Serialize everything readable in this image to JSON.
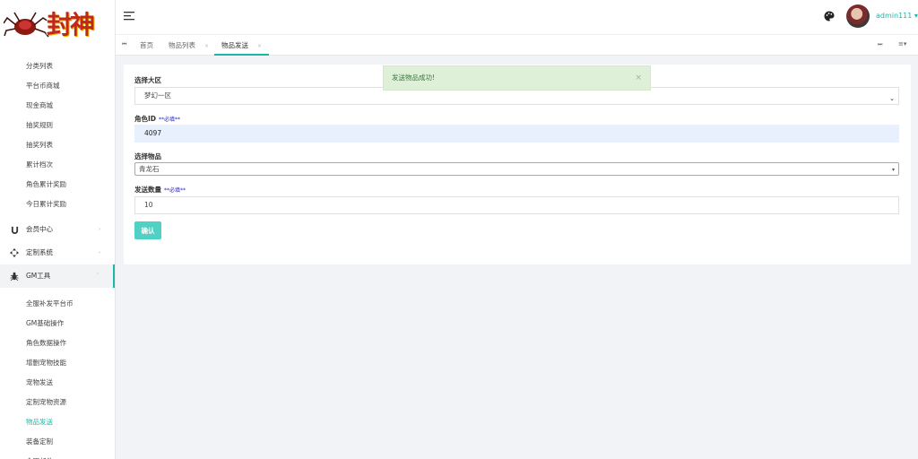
{
  "logo": {
    "text": "封神"
  },
  "sidebar": {
    "items_top": [
      "分类列表",
      "平台币商城",
      "现金商城",
      "抽奖规则",
      "抽奖列表",
      "累计档次",
      "角色累计奖励",
      "今日累计奖励"
    ],
    "groups": [
      {
        "label": "会员中心",
        "icon": "magnet-icon"
      },
      {
        "label": "定制系统",
        "icon": "move-icon"
      },
      {
        "label": "GM工具",
        "icon": "bug-icon"
      }
    ],
    "items_gm": [
      "全服补发平台币",
      "GM基础操作",
      "角色数据操作",
      "增删宠物技能",
      "宠物发送",
      "定制宠物资源",
      "物品发送",
      "装备定制",
      "全服邮件"
    ],
    "active_item": "物品发送"
  },
  "header": {
    "username": "admin111",
    "accent_color": "#1ab8a8"
  },
  "tabs": [
    {
      "label": "首页",
      "closable": false
    },
    {
      "label": "物品列表",
      "closable": true
    },
    {
      "label": "物品发送",
      "closable": true,
      "active": true
    }
  ],
  "form": {
    "region_label": "选择大区",
    "region_value": "梦幻一区",
    "role_label": "角色ID",
    "role_required": "**必填**",
    "role_value": "4097",
    "item_label": "选择物品",
    "item_value": "青龙石",
    "qty_label": "发送数量",
    "qty_required": "**必填**",
    "qty_value": "10",
    "confirm_label": "确认"
  },
  "toast": {
    "message": "发送物品成功!",
    "close": "×"
  }
}
